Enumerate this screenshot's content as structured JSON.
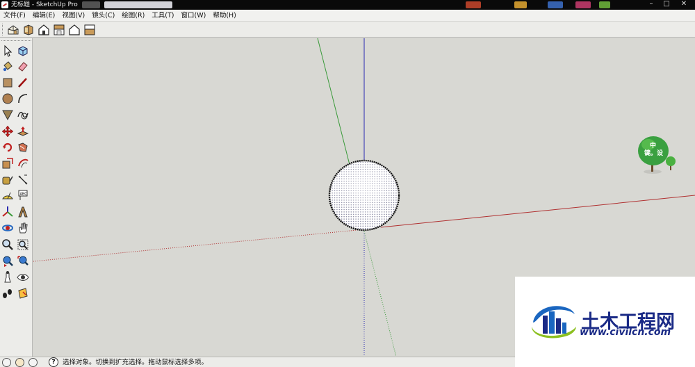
{
  "window": {
    "title": "无标题 - SketchUp Pro",
    "controls": [
      "–",
      "□",
      "✕"
    ]
  },
  "menu": [
    {
      "label": "文件(F)"
    },
    {
      "label": "编辑(E)"
    },
    {
      "label": "视图(V)"
    },
    {
      "label": "镜头(C)"
    },
    {
      "label": "绘图(R)"
    },
    {
      "label": "工具(T)"
    },
    {
      "label": "窗口(W)"
    },
    {
      "label": "帮助(H)"
    }
  ],
  "toolbar": {
    "views": [
      "iso-view-icon",
      "top-view-icon",
      "front-view-icon",
      "right-view-icon",
      "back-view-icon",
      "left-view-icon"
    ]
  },
  "palette": {
    "tools": [
      "select-arrow-icon",
      "make-component-icon",
      "paint-bucket-icon",
      "eraser-icon",
      "rectangle-icon",
      "pencil-line-icon",
      "circle-icon",
      "arc-icon",
      "polygon-icon",
      "freehand-icon",
      "move-icon",
      "push-pull-icon",
      "rotate-icon",
      "follow-me-icon",
      "scale-icon",
      "offset-icon",
      "tape-measure-icon",
      "dimension-icon",
      "protractor-icon",
      "text-icon",
      "axes-icon",
      "3d-text-icon",
      "orbit-icon",
      "pan-hand-icon",
      "zoom-icon",
      "zoom-window-icon",
      "previous-view-icon",
      "zoom-extents-icon",
      "position-camera-icon",
      "look-around-icon",
      "walk-icon",
      "section-plane-icon"
    ]
  },
  "scene": {
    "tree_label": {
      "line1": "中",
      "line2": "键。设"
    },
    "colors": {
      "red_axis": "#b03030",
      "green_axis": "#3a9a3a",
      "blue_axis": "#2a2ab0",
      "background": "#d8d8d3"
    }
  },
  "status": {
    "text": "选择对象。切换到扩充选择。拖动鼠标选择多项。"
  },
  "watermark": {
    "brand": "土木工程网",
    "url": "www.civilcn.com"
  }
}
